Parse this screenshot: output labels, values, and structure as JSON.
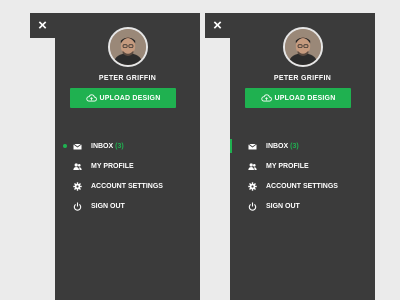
{
  "colors": {
    "panel": "#3b3b3b",
    "background": "#ebebeb",
    "accent": "#1fb150",
    "text": "#ffffff"
  },
  "panels": [
    {
      "close_label": "×",
      "user_name": "PETER GRIFFIN",
      "upload_label": "UPLOAD DESIGN",
      "active_indicator": "dot",
      "menu": [
        {
          "label": "INBOX",
          "count": "(3)",
          "icon": "mail-icon",
          "active": true
        },
        {
          "label": "MY PROFILE",
          "count": "",
          "icon": "users-icon",
          "active": false
        },
        {
          "label": "ACCOUNT SETTINGS",
          "count": "",
          "icon": "gear-icon",
          "active": false
        },
        {
          "label": "SIGN OUT",
          "count": "",
          "icon": "power-icon",
          "active": false
        }
      ]
    },
    {
      "close_label": "×",
      "user_name": "PETER GRIFFIN",
      "upload_label": "UPLOAD DESIGN",
      "active_indicator": "bar",
      "menu": [
        {
          "label": "INBOX",
          "count": "(3)",
          "icon": "mail-icon",
          "active": true
        },
        {
          "label": "MY PROFILE",
          "count": "",
          "icon": "users-icon",
          "active": false
        },
        {
          "label": "ACCOUNT SETTINGS",
          "count": "",
          "icon": "gear-icon",
          "active": false
        },
        {
          "label": "SIGN OUT",
          "count": "",
          "icon": "power-icon",
          "active": false
        }
      ]
    }
  ]
}
